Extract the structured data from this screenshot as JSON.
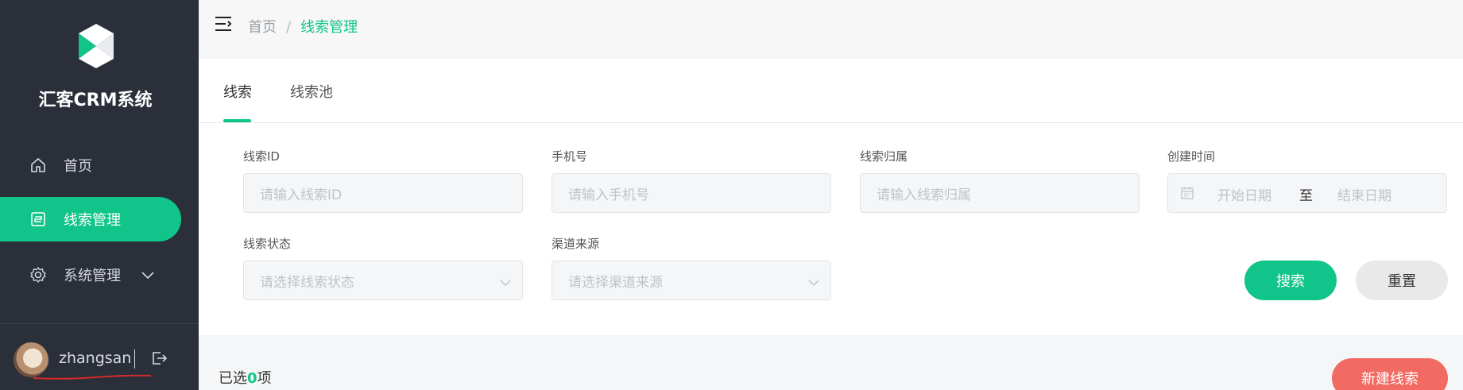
{
  "app": {
    "title": "汇客CRM系统"
  },
  "sidebar": {
    "items": [
      {
        "label": "首页",
        "icon": "home-icon"
      },
      {
        "label": "线索管理",
        "icon": "clue-icon",
        "active": true
      },
      {
        "label": "系统管理",
        "icon": "gear-icon"
      }
    ]
  },
  "user": {
    "name": "zhangsan"
  },
  "breadcrumb": {
    "home": "首页",
    "separator": "/",
    "current": "线索管理"
  },
  "tabs": [
    {
      "label": "线索"
    },
    {
      "label": "线索池"
    }
  ],
  "filters": {
    "clue_id": {
      "label": "线索ID",
      "placeholder": "请输入线索ID"
    },
    "phone": {
      "label": "手机号",
      "placeholder": "请输入手机号"
    },
    "owner": {
      "label": "线索归属",
      "placeholder": "请输入线索归属"
    },
    "created": {
      "label": "创建时间",
      "start_placeholder": "开始日期",
      "range_sep": "至",
      "end_placeholder": "结束日期"
    },
    "status": {
      "label": "线索状态",
      "placeholder": "请选择线索状态"
    },
    "channel": {
      "label": "渠道来源",
      "placeholder": "请选择渠道来源"
    }
  },
  "actions": {
    "search": "搜索",
    "reset": "重置",
    "new_clue": "新建线索"
  },
  "selection": {
    "prefix": "已选",
    "count": "0",
    "suffix": "项"
  },
  "colors": {
    "accent": "#11c48a",
    "sidebar_bg": "#2a2f3a",
    "danger": "#f26b62"
  }
}
